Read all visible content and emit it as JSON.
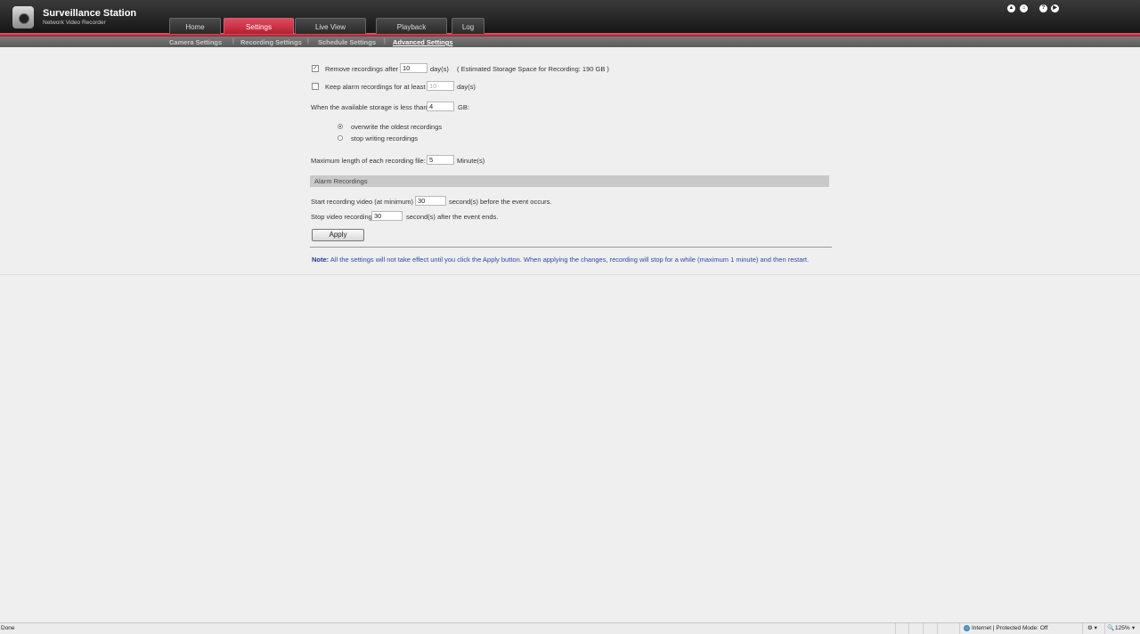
{
  "app": {
    "title": "Surveillance Station",
    "subtitle": "Network Video Recorder"
  },
  "tabs": [
    {
      "label": "Home",
      "active": false
    },
    {
      "label": "Settings",
      "active": true
    },
    {
      "label": "Live View",
      "active": false
    },
    {
      "label": "Playback",
      "active": false
    },
    {
      "label": "Log",
      "active": false
    }
  ],
  "top_icons": [
    "arrow-up-icon",
    "home-icon",
    "help-icon",
    "logout-icon"
  ],
  "subnav": [
    {
      "label": "Camera Settings",
      "active": false
    },
    {
      "label": "Recording Settings",
      "active": false
    },
    {
      "label": "Schedule Settings",
      "active": false
    },
    {
      "label": "Advanced Settings",
      "active": true
    }
  ],
  "form": {
    "remove_label": "Remove recordings after",
    "remove_value": "10",
    "remove_unit": "day(s)",
    "storage_estimate": "( Estimated Storage Space for Recording:  190 GB )",
    "remove_checked": true,
    "keep_label": "Keep alarm recordings for at least",
    "keep_value": "10",
    "keep_unit": "day(s)",
    "keep_checked": false,
    "available_label": "When the available storage is less than",
    "available_value": "4",
    "available_unit": "GB:",
    "radio_overwrite": "overwrite the oldest recordings",
    "radio_stop": "stop writing recordings",
    "selected_radio": "overwrite",
    "maxlen_label": "Maximum length of each recording file:",
    "maxlen_value": "5",
    "maxlen_unit": "Minute(s)"
  },
  "alarm": {
    "section_title": "Alarm Recordings",
    "start_label": "Start recording video (at minimum)",
    "start_value": "30",
    "start_unit": "second(s) before the event occurs.",
    "stop_label": "Stop video recording",
    "stop_value": "30",
    "stop_unit": "second(s) after the event ends."
  },
  "apply_label": "Apply",
  "note": {
    "prefix": "Note:",
    "text": " All the settings will not take effect until you click the Apply button. When applying the changes, recording will stop for a while (maximum 1 minute) and then restart."
  },
  "status_bar": {
    "left": "Done",
    "zone": "Internet | Protected Mode: Off",
    "zoom": "125%"
  },
  "colors": {
    "accent_red": "#c8283c",
    "note_blue": "#2a49a8"
  }
}
